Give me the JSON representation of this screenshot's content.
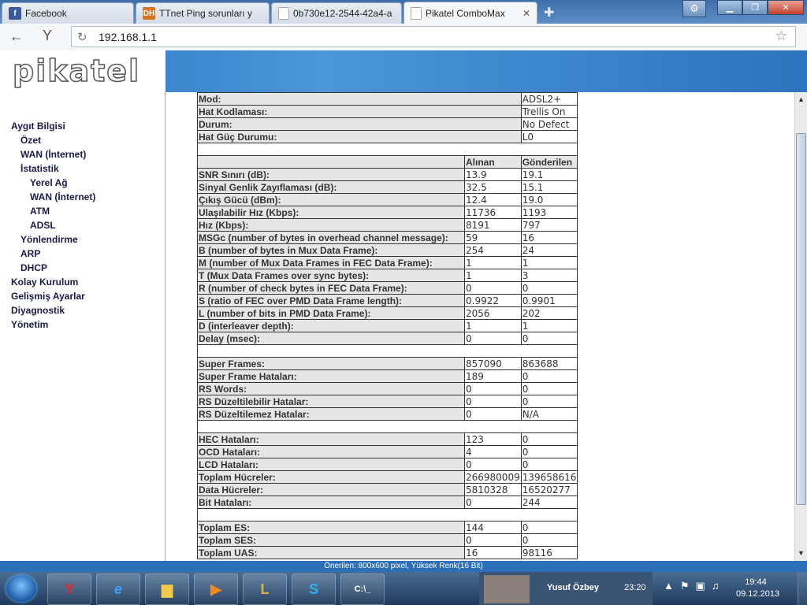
{
  "browser": {
    "tabs": [
      {
        "title": "Facebook",
        "favicon": "f",
        "favcolor": "#3b5998"
      },
      {
        "title": "TTnet Ping sorunları y",
        "favicon": "DH",
        "favcolor": "#d8731f"
      },
      {
        "title": "0b730e12-2544-42a4-a",
        "favicon": "",
        "favcolor": "#ffffff"
      },
      {
        "title": "Pikatel ComboMax",
        "favicon": "",
        "favcolor": "#ffffff"
      }
    ],
    "url": "192.168.1.1"
  },
  "page": {
    "logo": "pikatel",
    "status_text": "Önerilen: 800x600 pixel, Yüksek Renk(16 Bit)"
  },
  "sidebar": {
    "items": [
      "Aygıt Bilgisi",
      "Özet",
      "WAN (İnternet)",
      "İstatistik",
      "Yerel Ağ",
      "WAN (İnternet)",
      "ATM",
      "ADSL",
      "Yönlendirme",
      "ARP",
      "DHCP",
      "Kolay Kurulum",
      "Gelişmiş Ayarlar",
      "Diyagnostik",
      "Yönetim"
    ]
  },
  "stats": {
    "top": [
      [
        "Mod:",
        "ADSL2+"
      ],
      [
        "Hat Kodlaması:",
        "Trellis On"
      ],
      [
        "Durum:",
        "No Defect"
      ],
      [
        "Hat Güç Durumu:",
        "L0"
      ]
    ],
    "col_headers": [
      "Alınan",
      "Gönderilen"
    ],
    "line": [
      [
        "SNR Sınırı (dB):",
        "13.9",
        "19.1"
      ],
      [
        "Sinyal Genlik Zayıflaması (dB):",
        "32.5",
        "15.1"
      ],
      [
        "Çıkış Gücü (dBm):",
        "12.4",
        "19.0"
      ],
      [
        "Ulaşılabilir Hız (Kbps):",
        "11736",
        "1193"
      ],
      [
        "Hız (Kbps):",
        "8191",
        "797"
      ],
      [
        "MSGc (number of bytes in overhead channel message):",
        "59",
        "16"
      ],
      [
        "B (number of bytes in Mux Data Frame):",
        "254",
        "24"
      ],
      [
        "M (number of Mux Data Frames in FEC Data Frame):",
        "1",
        "1"
      ],
      [
        "T (Mux Data Frames over sync bytes):",
        "1",
        "3"
      ],
      [
        "R (number of check bytes in FEC Data Frame):",
        "0",
        "0"
      ],
      [
        "S (ratio of FEC over PMD Data Frame length):",
        "0.9922",
        "0.9901"
      ],
      [
        "L (number of bits in PMD Data Frame):",
        "2056",
        "202"
      ],
      [
        "D (interleaver depth):",
        "1",
        "1"
      ],
      [
        "Delay (msec):",
        "0",
        "0"
      ]
    ],
    "frames": [
      [
        "Super Frames:",
        "857090",
        "863688"
      ],
      [
        "Super Frame Hataları:",
        "189",
        "0"
      ],
      [
        "RS Words:",
        "0",
        "0"
      ],
      [
        "RS Düzeltilebilir Hatalar:",
        "0",
        "0"
      ],
      [
        "RS Düzeltilemez Hatalar:",
        "0",
        "N/A"
      ]
    ],
    "cells": [
      [
        "HEC Hataları:",
        "123",
        "0"
      ],
      [
        "OCD Hataları:",
        "4",
        "0"
      ],
      [
        "LCD Hataları:",
        "0",
        "0"
      ],
      [
        "Toplam Hücreler:",
        "266980009",
        "139658616"
      ],
      [
        "Data Hücreler:",
        "5810328",
        "16520277"
      ],
      [
        "Bit Hataları:",
        "0",
        "244"
      ]
    ],
    "errors": [
      [
        "Toplam ES:",
        "144",
        "0"
      ],
      [
        "Toplam SES:",
        "0",
        "0"
      ],
      [
        "Toplam UAS:",
        "16",
        "98116"
      ]
    ]
  },
  "taskbar": {
    "notification_name": "Yusuf Özbey",
    "notification_time": "23:20",
    "clock_time": "19:44",
    "clock_date": "09.12.2013"
  }
}
